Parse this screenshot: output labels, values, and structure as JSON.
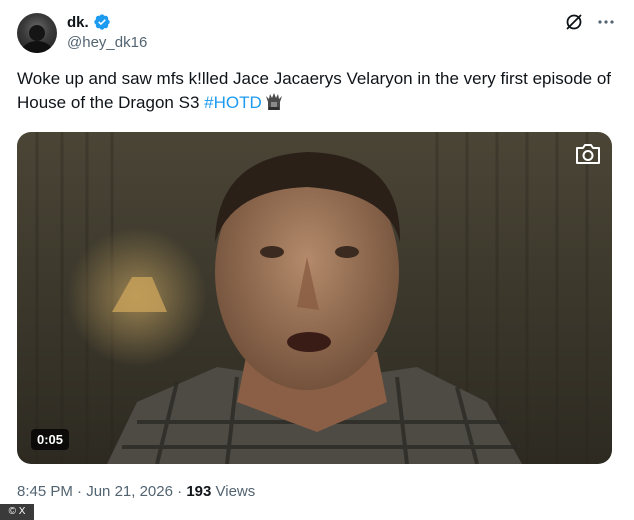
{
  "author": {
    "display_name": "dk.",
    "handle": "@hey_dk16",
    "verified": true,
    "verified_color": "#1d9bf0"
  },
  "tweet": {
    "text": "Woke up and saw mfs k!lled Jace Jacaerys Velaryon in the very first episode of House of the Dragon S3 ",
    "hashtag": "#HOTD",
    "hashtag_color": "#1d9bf0",
    "emoji_icon": "iron-throne-icon"
  },
  "media": {
    "type": "video",
    "duration": "0:05",
    "overlay_icon": "camera-icon"
  },
  "meta": {
    "time": "8:45 PM",
    "separator1": " · ",
    "date": "Jun 21, 2026",
    "separator2": " · ",
    "views_count": "193",
    "views_label": " Views"
  },
  "top_actions": [
    "grok-icon",
    "more-icon"
  ],
  "watermark": "© X"
}
